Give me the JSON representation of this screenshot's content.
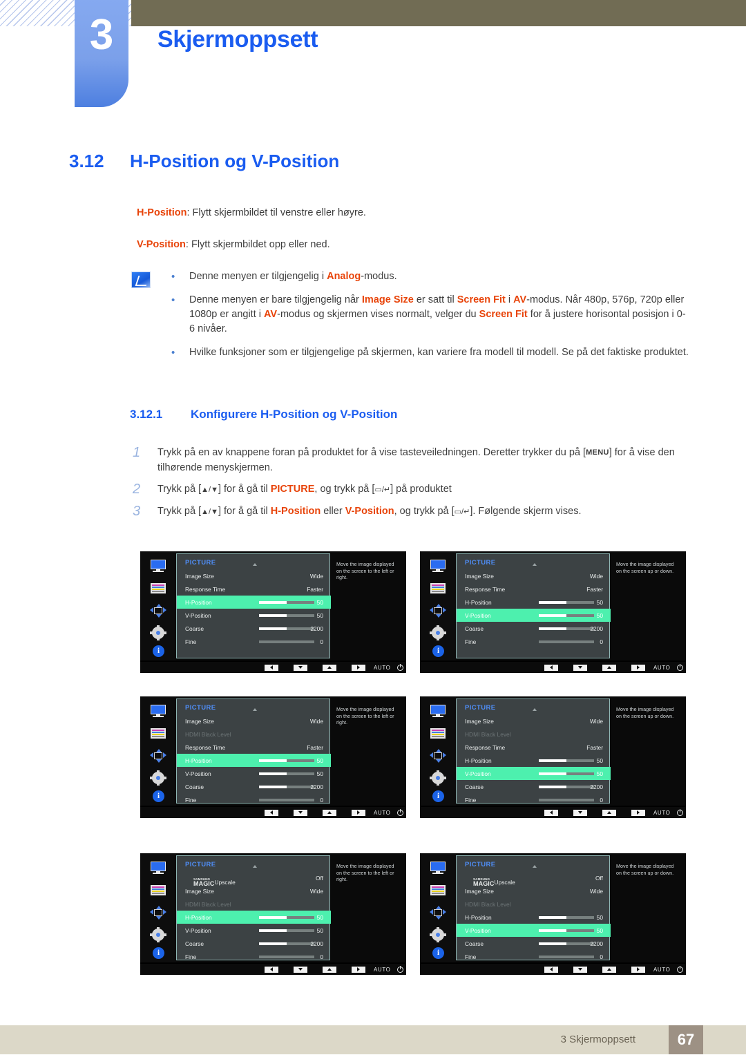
{
  "header": {
    "chapter_number": "3",
    "chapter_title": "Skjermoppsett"
  },
  "section": {
    "number": "3.12",
    "title": "H-Position og V-Position"
  },
  "intro": {
    "line1_keyword": "H-Position",
    "line1_rest": ": Flytt skjermbildet til venstre eller høyre.",
    "line2_keyword": "V-Position",
    "line2_rest": ": Flytt skjermbildet opp eller ned."
  },
  "notes": {
    "icon": "note-pencil-icon",
    "bullet_glyph": "•",
    "items": [
      {
        "parts": [
          {
            "t": "Denne menyen er tilgjengelig i ",
            "s": "n"
          },
          {
            "t": "Analog",
            "s": "kw"
          },
          {
            "t": "-modus.",
            "s": "n"
          }
        ]
      },
      {
        "parts": [
          {
            "t": "Denne menyen er bare tilgjengelig når ",
            "s": "n"
          },
          {
            "t": "Image Size",
            "s": "kw"
          },
          {
            "t": " er satt til ",
            "s": "n"
          },
          {
            "t": "Screen Fit",
            "s": "kw"
          },
          {
            "t": " i ",
            "s": "n"
          },
          {
            "t": "AV",
            "s": "kw"
          },
          {
            "t": "-modus. Når 480p, 576p, 720p eller 1080p er angitt i ",
            "s": "n"
          },
          {
            "t": "AV",
            "s": "kw"
          },
          {
            "t": "-modus og skjermen vises normalt, velger du ",
            "s": "n"
          },
          {
            "t": "Screen Fit",
            "s": "kw"
          },
          {
            "t": " for å justere horisontal posisjon i 0-6 nivåer.",
            "s": "n"
          }
        ]
      },
      {
        "parts": [
          {
            "t": "Hvilke funksjoner som er tilgjengelige på skjermen, kan variere fra modell til modell. Se på det faktiske produktet.",
            "s": "n"
          }
        ]
      }
    ]
  },
  "subsection": {
    "number": "3.12.1",
    "title": "Konfigurere H-Position og V-Position"
  },
  "steps": [
    {
      "number": "1",
      "parts": [
        {
          "t": "Trykk på en av knappene foran på produktet for å vise tasteveiledningen. Deretter trykker du på [",
          "s": "n"
        },
        {
          "t": "MENU",
          "s": "keycap"
        },
        {
          "t": "] for å vise den tilhørende menyskjermen.",
          "s": "n"
        }
      ]
    },
    {
      "number": "2",
      "parts": [
        {
          "t": "Trykk på [",
          "s": "n"
        },
        {
          "t": "▲/▼",
          "s": "glyph"
        },
        {
          "t": "] for å gå til ",
          "s": "n"
        },
        {
          "t": "PICTURE",
          "s": "kw"
        },
        {
          "t": ", og trykk på [",
          "s": "n"
        },
        {
          "t": "▭/↵",
          "s": "glyph"
        },
        {
          "t": "] på produktet",
          "s": "n"
        }
      ]
    },
    {
      "number": "3",
      "parts": [
        {
          "t": "Trykk på [",
          "s": "n"
        },
        {
          "t": "▲/▼",
          "s": "glyph"
        },
        {
          "t": "] for å gå til ",
          "s": "n"
        },
        {
          "t": "H-Position",
          "s": "kw"
        },
        {
          "t": " eller ",
          "s": "n"
        },
        {
          "t": "V-Position",
          "s": "kw"
        },
        {
          "t": ", og trykk på [",
          "s": "n"
        },
        {
          "t": "▭/↵",
          "s": "glyph"
        },
        {
          "t": "]. Følgende skjerm vises.",
          "s": "n"
        }
      ]
    }
  ],
  "osd_common": {
    "title": "PICTURE",
    "rail_icons": [
      "monitor-icon",
      "color-bars-icon",
      "position-arrows-icon",
      "gear-icon",
      "info-icon"
    ],
    "footer_buttons": [
      "left-arrow",
      "down-arrow",
      "up-arrow",
      "right-arrow"
    ],
    "footer_auto": "AUTO",
    "footer_power": "power-icon",
    "help_h": "Move the image displayed on the screen to the left or right.",
    "help_v": "Move the image displayed on the screen up or down.",
    "highlight_color": "#4df0ae",
    "menu_bg": "#3c4244",
    "title_color": "#4f8ef7"
  },
  "osd_screens": [
    {
      "id": "osd-1-h-position",
      "help": "Move the image displayed on the screen to the left or right.",
      "rows": [
        {
          "label": "Image Size",
          "value": "Wide",
          "bar": null,
          "state": "normal"
        },
        {
          "label": "Response Time",
          "value": "Faster",
          "bar": null,
          "state": "normal"
        },
        {
          "label": "H-Position",
          "value": "50",
          "bar": 50,
          "state": "highlight"
        },
        {
          "label": "V-Position",
          "value": "50",
          "bar": 50,
          "state": "normal"
        },
        {
          "label": "Coarse",
          "value": "2200",
          "bar": 50,
          "state": "normal"
        },
        {
          "label": "Fine",
          "value": "0",
          "bar": 0,
          "state": "normal"
        }
      ]
    },
    {
      "id": "osd-2-v-position",
      "help": "Move the image displayed on the screen up or down.",
      "rows": [
        {
          "label": "Image Size",
          "value": "Wide",
          "bar": null,
          "state": "normal"
        },
        {
          "label": "Response Time",
          "value": "Faster",
          "bar": null,
          "state": "normal"
        },
        {
          "label": "H-Position",
          "value": "50",
          "bar": 50,
          "state": "normal"
        },
        {
          "label": "V-Position",
          "value": "50",
          "bar": 50,
          "state": "highlight"
        },
        {
          "label": "Coarse",
          "value": "2200",
          "bar": 50,
          "state": "normal"
        },
        {
          "label": "Fine",
          "value": "0",
          "bar": 0,
          "state": "normal"
        }
      ]
    },
    {
      "id": "osd-3-h-position-hdmi",
      "help": "Move the image displayed on the screen to the left or right.",
      "rows": [
        {
          "label": "Image Size",
          "value": "Wide",
          "bar": null,
          "state": "normal"
        },
        {
          "label": "HDMI Black Level",
          "value": "",
          "bar": null,
          "state": "dim"
        },
        {
          "label": "Response Time",
          "value": "Faster",
          "bar": null,
          "state": "normal"
        },
        {
          "label": "H-Position",
          "value": "50",
          "bar": 50,
          "state": "highlight"
        },
        {
          "label": "V-Position",
          "value": "50",
          "bar": 50,
          "state": "normal"
        },
        {
          "label": "Coarse",
          "value": "2200",
          "bar": 50,
          "state": "normal"
        },
        {
          "label": "Fine",
          "value": "0",
          "bar": 0,
          "state": "normal"
        }
      ]
    },
    {
      "id": "osd-4-v-position-hdmi",
      "help": "Move the image displayed on the screen up or down.",
      "rows": [
        {
          "label": "Image Size",
          "value": "Wide",
          "bar": null,
          "state": "normal"
        },
        {
          "label": "HDMI Black Level",
          "value": "",
          "bar": null,
          "state": "dim"
        },
        {
          "label": "Response Time",
          "value": "Faster",
          "bar": null,
          "state": "normal"
        },
        {
          "label": "H-Position",
          "value": "50",
          "bar": 50,
          "state": "normal"
        },
        {
          "label": "V-Position",
          "value": "50",
          "bar": 50,
          "state": "highlight"
        },
        {
          "label": "Coarse",
          "value": "2200",
          "bar": 50,
          "state": "normal"
        },
        {
          "label": "Fine",
          "value": "0",
          "bar": 0,
          "state": "normal"
        }
      ]
    },
    {
      "id": "osd-5-h-position-magic",
      "help": "Move the image displayed on the screen to the left or right.",
      "rows": [
        {
          "label": "SAMSUNG MAGIC Upscale",
          "magic": {
            "small": "SAMSUNG",
            "big": "MAGIC",
            "tail": "Upscale"
          },
          "value": "Off",
          "bar": null,
          "state": "normal"
        },
        {
          "label": "Image Size",
          "value": "Wide",
          "bar": null,
          "state": "normal"
        },
        {
          "label": "HDMI Black Level",
          "value": "",
          "bar": null,
          "state": "dim"
        },
        {
          "label": "H-Position",
          "value": "50",
          "bar": 50,
          "state": "highlight"
        },
        {
          "label": "V-Position",
          "value": "50",
          "bar": 50,
          "state": "normal"
        },
        {
          "label": "Coarse",
          "value": "2200",
          "bar": 50,
          "state": "normal"
        },
        {
          "label": "Fine",
          "value": "0",
          "bar": 0,
          "state": "normal"
        }
      ]
    },
    {
      "id": "osd-6-v-position-magic",
      "help": "Move the image displayed on the screen up or down.",
      "rows": [
        {
          "label": "SAMSUNG MAGIC Upscale",
          "magic": {
            "small": "SAMSUNG",
            "big": "MAGIC",
            "tail": "Upscale"
          },
          "value": "Off",
          "bar": null,
          "state": "normal"
        },
        {
          "label": "Image Size",
          "value": "Wide",
          "bar": null,
          "state": "normal"
        },
        {
          "label": "HDMI Black Level",
          "value": "",
          "bar": null,
          "state": "dim"
        },
        {
          "label": "H-Position",
          "value": "50",
          "bar": 50,
          "state": "normal"
        },
        {
          "label": "V-Position",
          "value": "50",
          "bar": 50,
          "state": "highlight"
        },
        {
          "label": "Coarse",
          "value": "2200",
          "bar": 50,
          "state": "normal"
        },
        {
          "label": "Fine",
          "value": "0",
          "bar": 0,
          "state": "normal"
        }
      ]
    }
  ],
  "footer": {
    "text": "3 Skjermoppsett",
    "page_number": "67"
  }
}
